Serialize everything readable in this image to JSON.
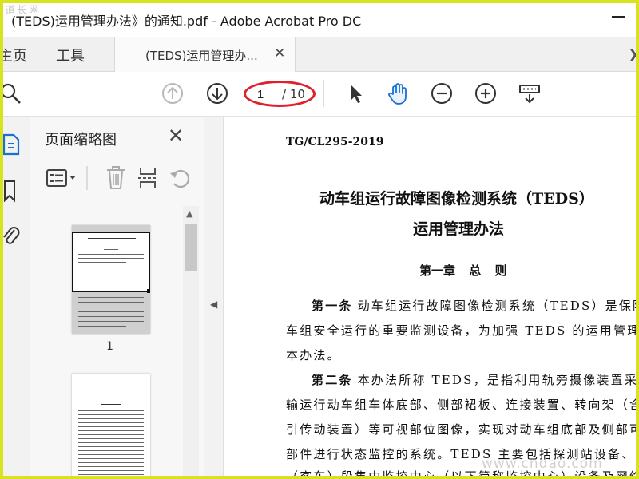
{
  "window": {
    "title": "(TEDS)运用管理办法》的通知.pdf - Adobe Acrobat Pro DC",
    "logo_text": "道长网"
  },
  "tabs": {
    "home": "主页",
    "tools": "工具",
    "document": "(TEDS)运用管理办...",
    "close_glyph": "✕",
    "scroll_glyph": "❯"
  },
  "toolbar": {
    "page_current": "1",
    "page_total": "/ 10",
    "highlight_color": "#e0202a"
  },
  "thumbnails": {
    "panel_title": "页面缩略图",
    "close_glyph": "✕",
    "pages": [
      {
        "label": "1"
      }
    ]
  },
  "document": {
    "code": "TG/CL295-2019",
    "title_line1": "动车组运行故障图像检测系统（TEDS）",
    "title_line2": "运用管理办法",
    "chapter": "第一章 总 则",
    "lines": [
      {
        "bold": "第一条",
        "text": "动车组运行故障图像检测系统（TEDS）是保障动"
      },
      {
        "bold": "",
        "text": "车组安全运行的重要监测设备，为加强 TEDS 的运用管理，制定"
      },
      {
        "bold": "",
        "text": "本办法。"
      },
      {
        "bold": "第二条",
        "text": "本办法所称 TEDS，是指利用轨旁摄像装置采集传"
      },
      {
        "bold": "",
        "text": "输运行动车组车体底部、侧部裙板、连接装置、转向架（含车"
      },
      {
        "bold": "",
        "text": "引传动装置）等可视部位图像，实现对动车组底部及侧部可视"
      },
      {
        "bold": "",
        "text": "部件进行状态监控的系统。TEDS 主要包括探测站设备、动车"
      },
      {
        "bold": "",
        "text": "（客车）段集中监控中心（以下简称监控中心）设备及网络传输"
      }
    ]
  },
  "site_watermark": "www.cndao.com",
  "colors": {
    "frame": "#d9e21f",
    "accent_blue": "#1a6fd6"
  }
}
